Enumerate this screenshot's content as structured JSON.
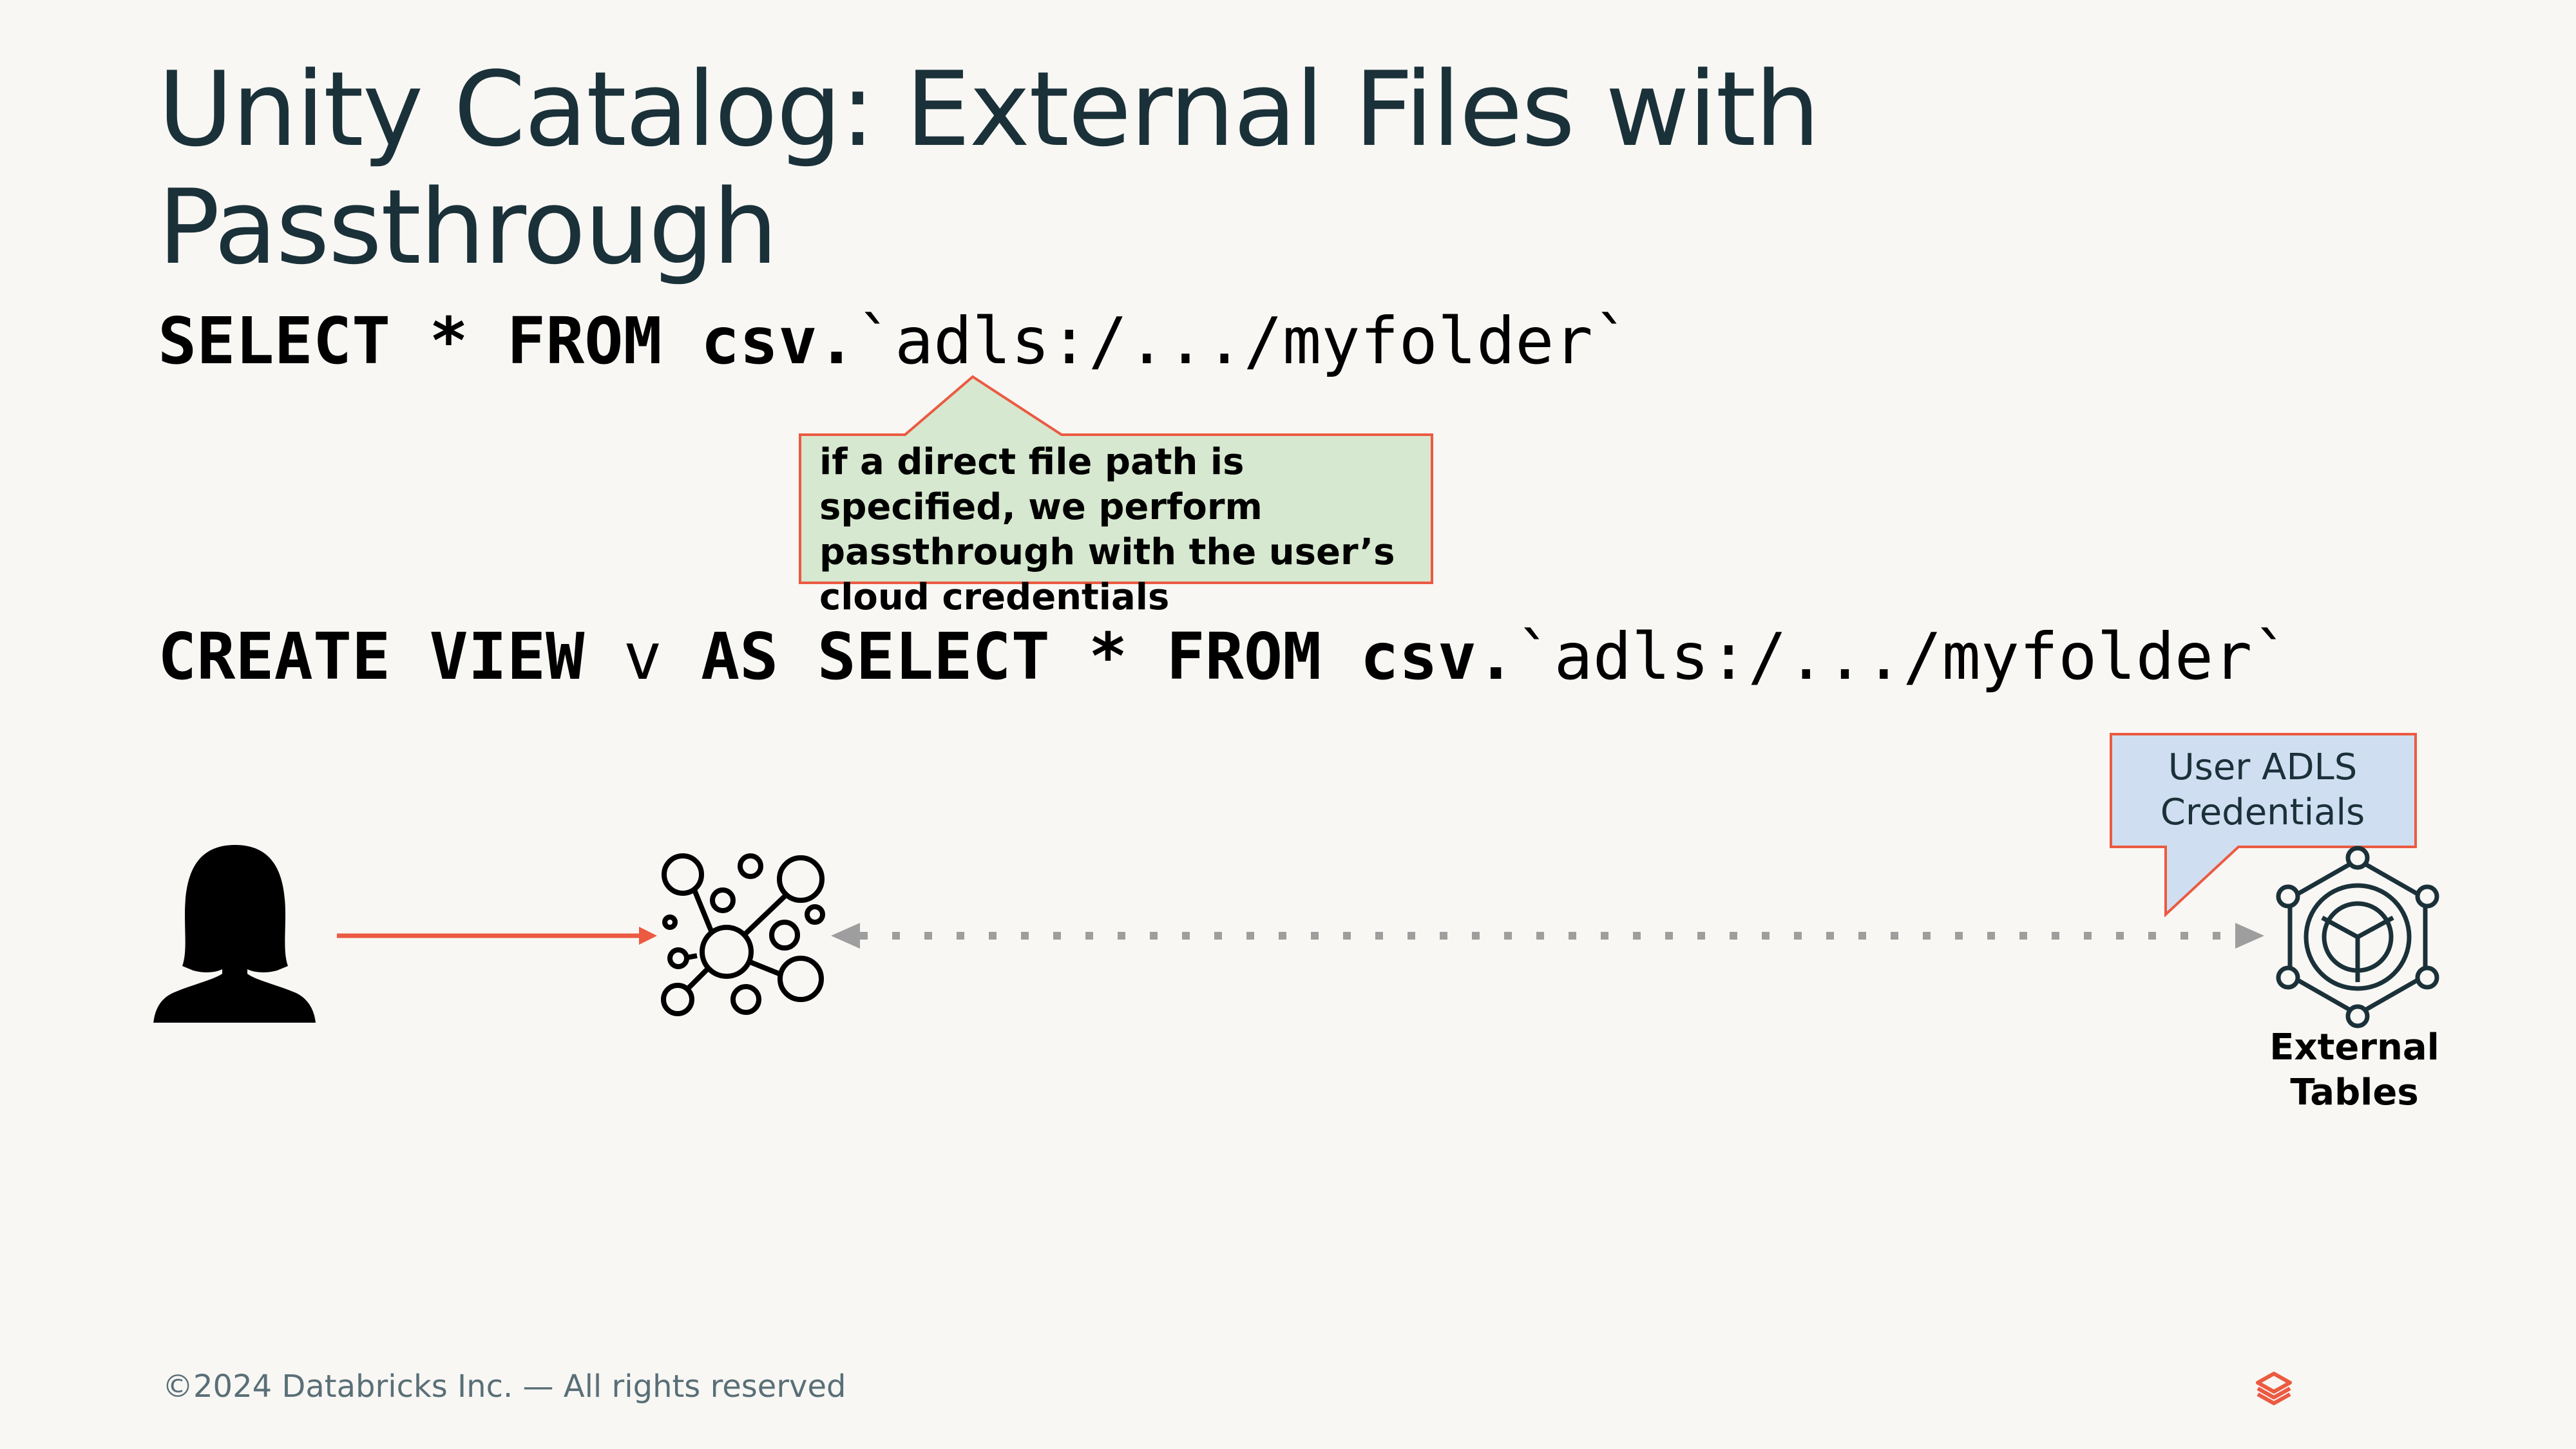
{
  "slide": {
    "title": "Unity Catalog: External Files with Passthrough",
    "sql_1": {
      "k1": "SELECT",
      "k2": "*",
      "k3": "FROM",
      "k4": "csv.",
      "path": "`adls:/.../myfolder`"
    },
    "sql_2": {
      "k1": "CREATE",
      "k2": "VIEW",
      "name": "v",
      "k3": "AS",
      "k4": "SELECT",
      "k5": "*",
      "k6": "FROM",
      "k7": "csv.",
      "path": "`adls:/.../myfolder`"
    },
    "callout_green": "if a direct file path is specified, we perform passthrough with the user’s cloud credentials",
    "callout_blue": "User ADLS Credentials",
    "external_label": "External Tables",
    "footer": "©2024 Databricks Inc. — All rights reserved"
  },
  "icons": {
    "user": "user-silhouette-icon",
    "compute": "network-nodes-icon",
    "external": "cube-network-icon",
    "logo": "databricks-logo-icon"
  },
  "colors": {
    "background": "#F8F7F4",
    "title": "#1B3139",
    "accent_red": "#EB5A41",
    "callout_green_fill": "#D6E8CF",
    "callout_blue_fill": "#CFDFF1",
    "dotted_arrow": "#9E9E9E"
  }
}
